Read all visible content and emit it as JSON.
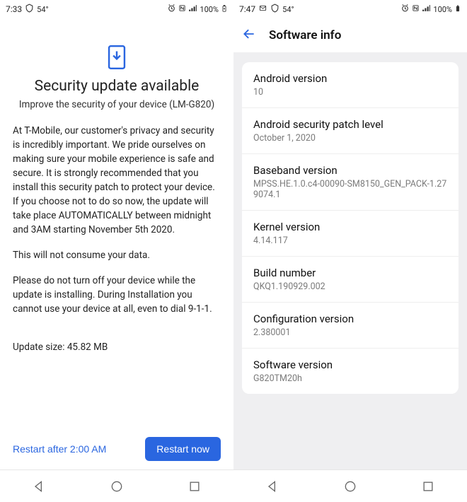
{
  "left": {
    "status": {
      "time": "7:33",
      "temp": "54°",
      "battery_pct": "100%"
    },
    "title": "Security update available",
    "subtitle": "Improve the security of your device (LM-G820)",
    "paragraphs": [
      "At T-Mobile, our customer's privacy and security is incredibly important. We pride ourselves on making sure your mobile experience is safe and secure. It is strongly recommended that you install this security patch to protect your device. If you choose not to do so now, the update will take place AUTOMATICALLY between midnight and 3AM starting November 5th 2020.",
      "This will not consume your data.",
      "Please do not turn off your device while the update is installing. During Installation you cannot use your device at all, even to dial 9-1-1."
    ],
    "size_line": "Update size: 45.82 MB",
    "restart_later": "Restart after 2:00 AM",
    "restart_now": "Restart now"
  },
  "right": {
    "status": {
      "time": "7:47",
      "temp": "54°",
      "battery_pct": "100%"
    },
    "appbar_title": "Software info",
    "items": [
      {
        "label": "Android version",
        "value": "10"
      },
      {
        "label": "Android security patch level",
        "value": "October 1, 2020"
      },
      {
        "label": "Baseband version",
        "value": "MPSS.HE.1.0.c4-00090-SM8150_GEN_PACK-1.279074.1"
      },
      {
        "label": "Kernel version",
        "value": "4.14.117"
      },
      {
        "label": "Build number",
        "value": "QKQ1.190929.002"
      },
      {
        "label": "Configuration version",
        "value": "2.380001"
      },
      {
        "label": "Software version",
        "value": "G820TM20h"
      }
    ]
  }
}
